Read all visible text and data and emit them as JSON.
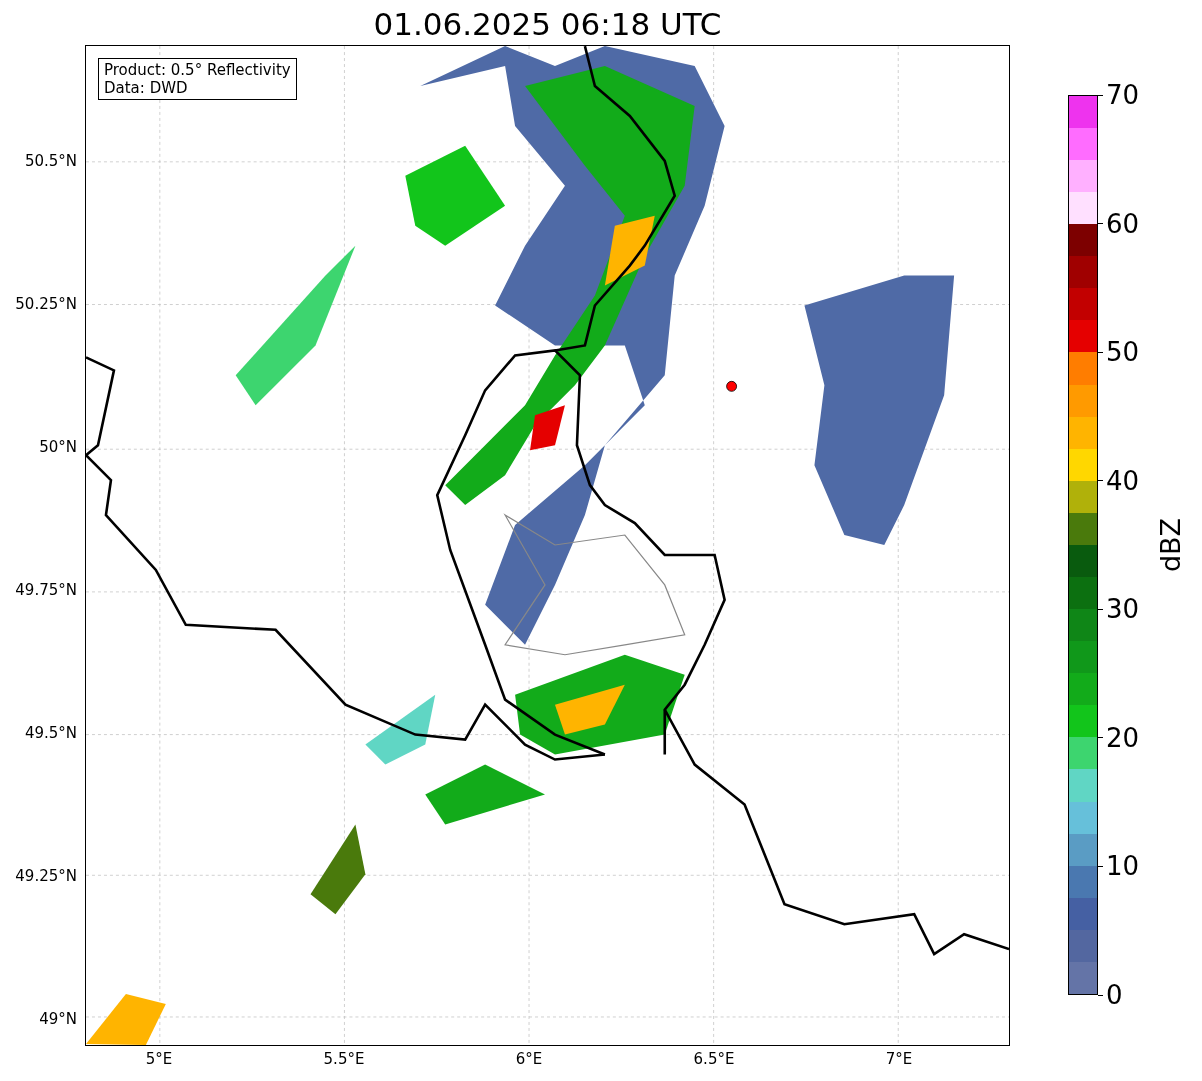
{
  "title": "01.06.2025 06:18 UTC",
  "legend": {
    "lines": [
      "Product: 0.5° Reflectivity",
      "Data: DWD"
    ]
  },
  "map": {
    "yticks": [
      "50.5°N",
      "50.25°N",
      "50°N",
      "49.75°N",
      "49.5°N",
      "49.25°N",
      "49°N"
    ],
    "xticks": [
      "5°E",
      "5.5°E",
      "6°E",
      "6.5°E",
      "7°E"
    ]
  },
  "colorbar": {
    "label": "dBZ",
    "ticks": [
      "70",
      "60",
      "50",
      "40",
      "30",
      "20",
      "10",
      "0"
    ],
    "segments": [
      {
        "color": "#6474a7"
      },
      {
        "color": "#5367a0"
      },
      {
        "color": "#4560a3"
      },
      {
        "color": "#4a78b0"
      },
      {
        "color": "#5a9cc4"
      },
      {
        "color": "#66c0da"
      },
      {
        "color": "#60d6c4"
      },
      {
        "color": "#3dd56f"
      },
      {
        "color": "#12c51b"
      },
      {
        "color": "#12ab1a"
      },
      {
        "color": "#10981a"
      },
      {
        "color": "#0f8617"
      },
      {
        "color": "#0c7010"
      },
      {
        "color": "#095b0e"
      },
      {
        "color": "#4a7a0c"
      },
      {
        "color": "#b0b10a"
      },
      {
        "color": "#ffd700"
      },
      {
        "color": "#ffb400"
      },
      {
        "color": "#ff9a00"
      },
      {
        "color": "#ff7d00"
      },
      {
        "color": "#e50000"
      },
      {
        "color": "#c20000"
      },
      {
        "color": "#a00000"
      },
      {
        "color": "#7d0000"
      },
      {
        "color": "#ffe0ff"
      },
      {
        "color": "#ffb0ff"
      },
      {
        "color": "#ff6cff"
      },
      {
        "color": "#ee33ee"
      }
    ]
  }
}
